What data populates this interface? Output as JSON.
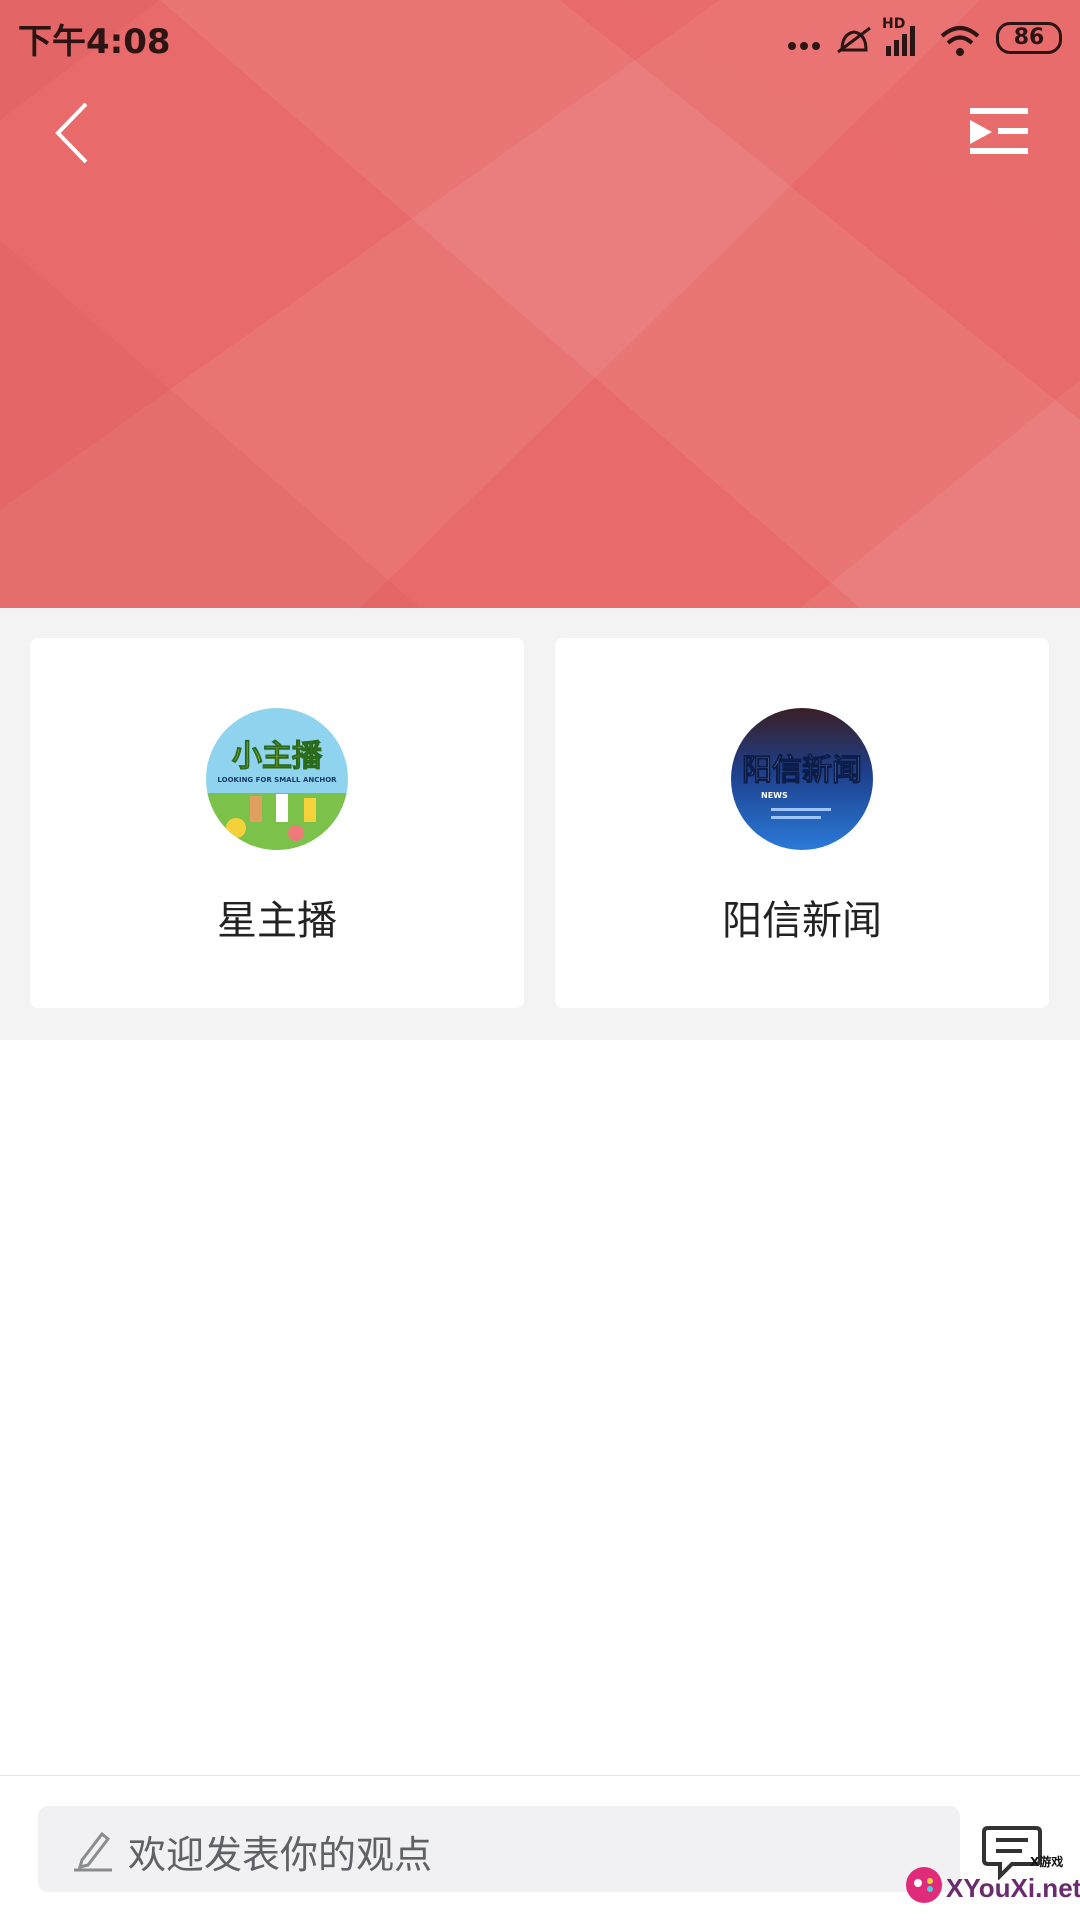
{
  "status_bar": {
    "time": "下午4:08",
    "network": "HD",
    "battery": "86",
    "icons": [
      "more-dots-icon",
      "mute-bell-icon",
      "signal-icon",
      "wifi-icon",
      "battery-icon"
    ]
  },
  "header": {
    "back_icon": "chevron-left-icon",
    "playlist_icon": "playlist-icon",
    "color": "#e86a6a"
  },
  "channels": [
    {
      "label": "星主播",
      "avatar_text": "小主播",
      "avatar_caption": "LOOKING FOR SMALL ANCHOR"
    },
    {
      "label": "阳信新闻",
      "avatar_text": "阳信新闻",
      "avatar_caption": "NEWS"
    }
  ],
  "comment_bar": {
    "placeholder": "欢迎发表你的观点",
    "comment_icon": "comment-icon"
  },
  "watermark": {
    "text": "XYouXi.net",
    "small": "X游戏"
  }
}
